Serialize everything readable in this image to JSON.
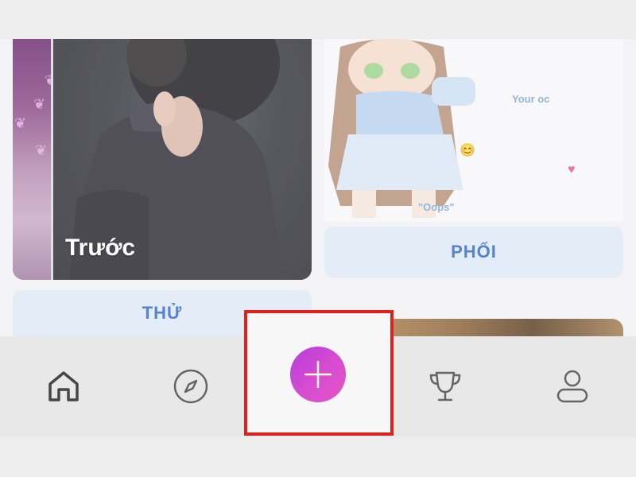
{
  "feed": {
    "left_card": {
      "caption": "Trước",
      "button_label": "THỬ"
    },
    "right_card": {
      "sticker_text_1": "Your oc",
      "sticker_text_2": "\"Oops\"",
      "button_label": "PHỐI"
    }
  },
  "bottom_nav": {
    "items": [
      {
        "name": "home",
        "icon": "home-icon"
      },
      {
        "name": "explore",
        "icon": "compass-icon"
      },
      {
        "name": "create",
        "icon": "plus-icon"
      },
      {
        "name": "leaderboard",
        "icon": "trophy-icon"
      },
      {
        "name": "profile",
        "icon": "user-icon"
      }
    ]
  },
  "colors": {
    "accent_gradient_start": "#b43bdc",
    "accent_gradient_end": "#e455c4",
    "button_text": "#2f69c6",
    "button_bg": "#dfe8f6",
    "highlight": "#e0201b"
  }
}
